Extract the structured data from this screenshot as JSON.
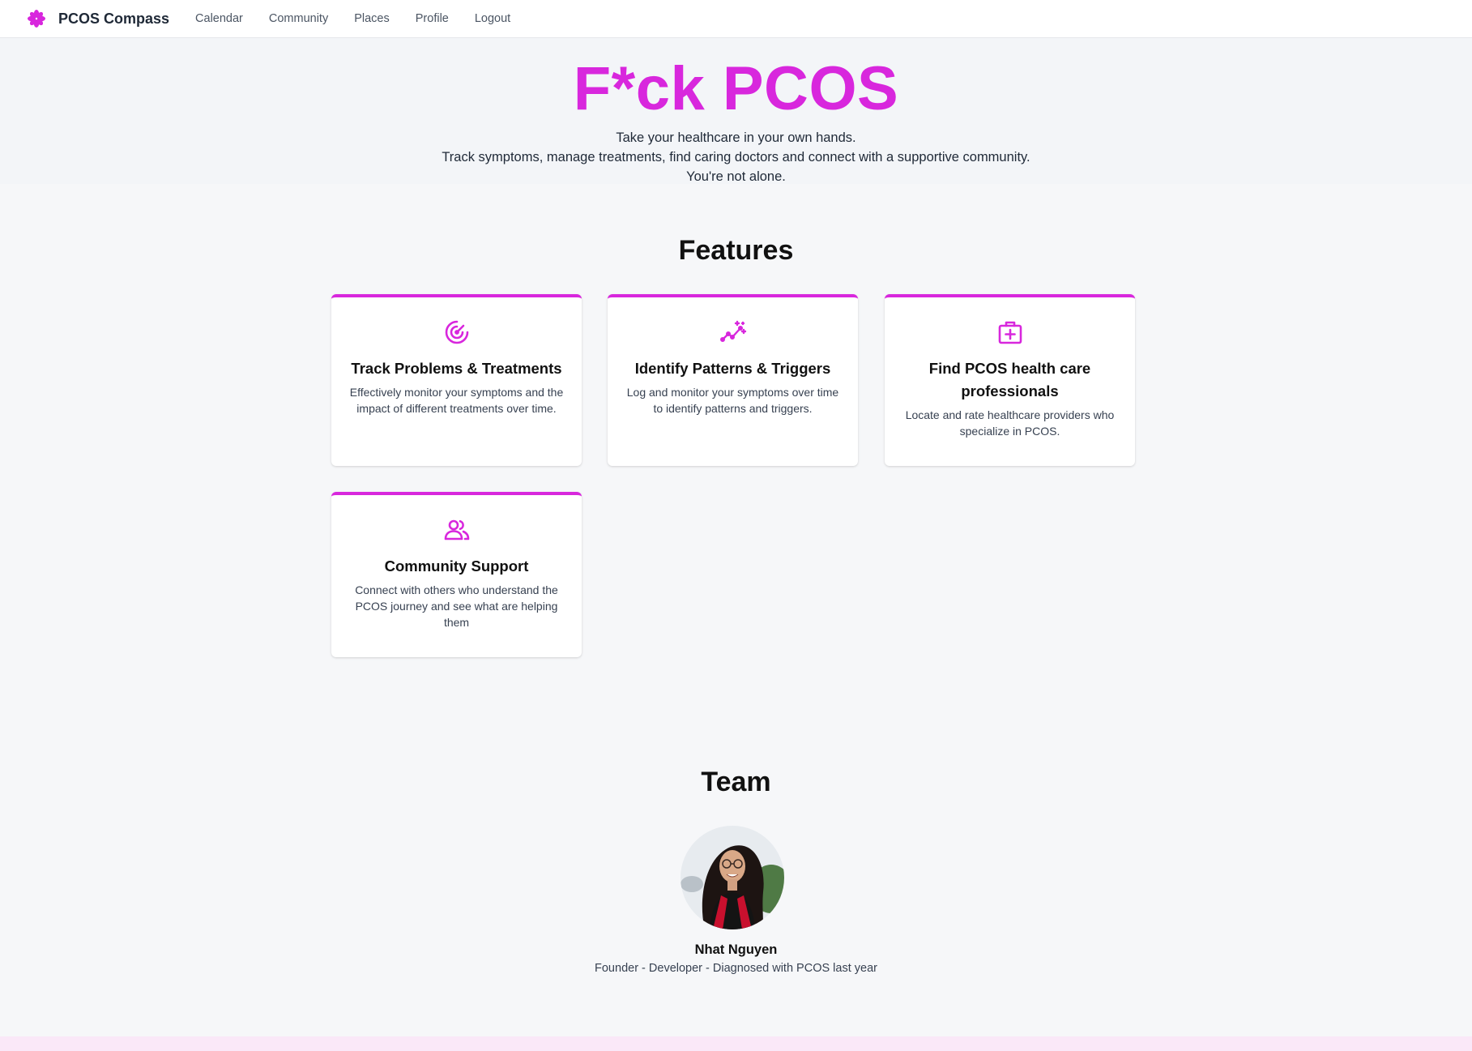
{
  "navbar": {
    "brand": "PCOS Compass",
    "brand_icon": "asterisk-flower-icon",
    "links": [
      "Calendar",
      "Community",
      "Places",
      "Profile",
      "Logout"
    ]
  },
  "hero": {
    "title": "F*ck PCOS",
    "line1": "Take your healthcare in your own hands.",
    "line2": "Track symptoms, manage treatments, find caring doctors and connect with a supportive community.",
    "line3": "You're not alone."
  },
  "features": {
    "heading": "Features",
    "cards": [
      {
        "icon": "target-icon",
        "title": "Track Problems & Treatments",
        "description": "Effectively monitor your symptoms and the impact of different treatments over time."
      },
      {
        "icon": "sparkle-trend-icon",
        "title": "Identify Patterns & Triggers",
        "description": "Log and monitor your symptoms over time to identify patterns and triggers."
      },
      {
        "icon": "medical-kit-icon",
        "title": "Find PCOS health care professionals",
        "description": "Locate and rate healthcare providers who specialize in PCOS."
      },
      {
        "icon": "users-icon",
        "title": "Community Support",
        "description": "Connect with others who understand the PCOS journey and see what are helping them"
      }
    ]
  },
  "team": {
    "heading": "Team",
    "members": [
      {
        "name": "Nhat Nguyen",
        "role": "Founder - Developer - Diagnosed with PCOS last year"
      }
    ]
  },
  "colors": {
    "accent": "#d827dd",
    "background": "#f6f7f9",
    "footer": "#fae8f8"
  }
}
